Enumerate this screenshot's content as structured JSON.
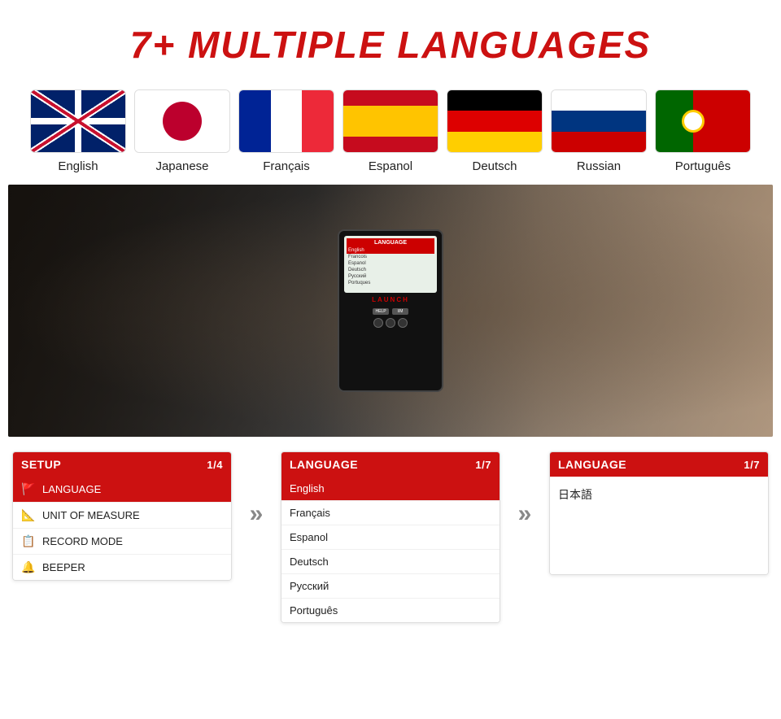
{
  "title": "7+ MULTIPLE LANGUAGES",
  "flags": [
    {
      "id": "english",
      "label": "English",
      "type": "uk"
    },
    {
      "id": "japanese",
      "label": "Japanese",
      "type": "japan"
    },
    {
      "id": "french",
      "label": "Français",
      "type": "france"
    },
    {
      "id": "spanish",
      "label": "Espanol",
      "type": "spain"
    },
    {
      "id": "german",
      "label": "Deutsch",
      "type": "germany"
    },
    {
      "id": "russian",
      "label": "Russian",
      "type": "russia"
    },
    {
      "id": "portuguese",
      "label": "Português",
      "type": "portugal"
    }
  ],
  "panel1": {
    "header": "SETUP",
    "page": "1/4",
    "rows": [
      {
        "icon": "🚩",
        "label": "LANGUAGE",
        "active": true
      },
      {
        "icon": "📏",
        "label": "UNIT OF MEASURE",
        "active": false
      },
      {
        "icon": "📋",
        "label": "RECORD MODE",
        "active": false
      },
      {
        "icon": "🔔",
        "label": "BEEPER",
        "active": false
      }
    ]
  },
  "panel2": {
    "header": "LANGUAGE",
    "page": "1/7",
    "rows": [
      {
        "label": "English",
        "active": true
      },
      {
        "label": "Français",
        "active": false
      },
      {
        "label": "Espanol",
        "active": false
      },
      {
        "label": "Deutsch",
        "active": false
      },
      {
        "label": "Русский",
        "active": false
      },
      {
        "label": "Português",
        "active": false
      }
    ]
  },
  "panel3": {
    "header": "LANGUAGE",
    "page": "1/7",
    "japanese_text": "日本語"
  },
  "arrow_symbol": "»"
}
